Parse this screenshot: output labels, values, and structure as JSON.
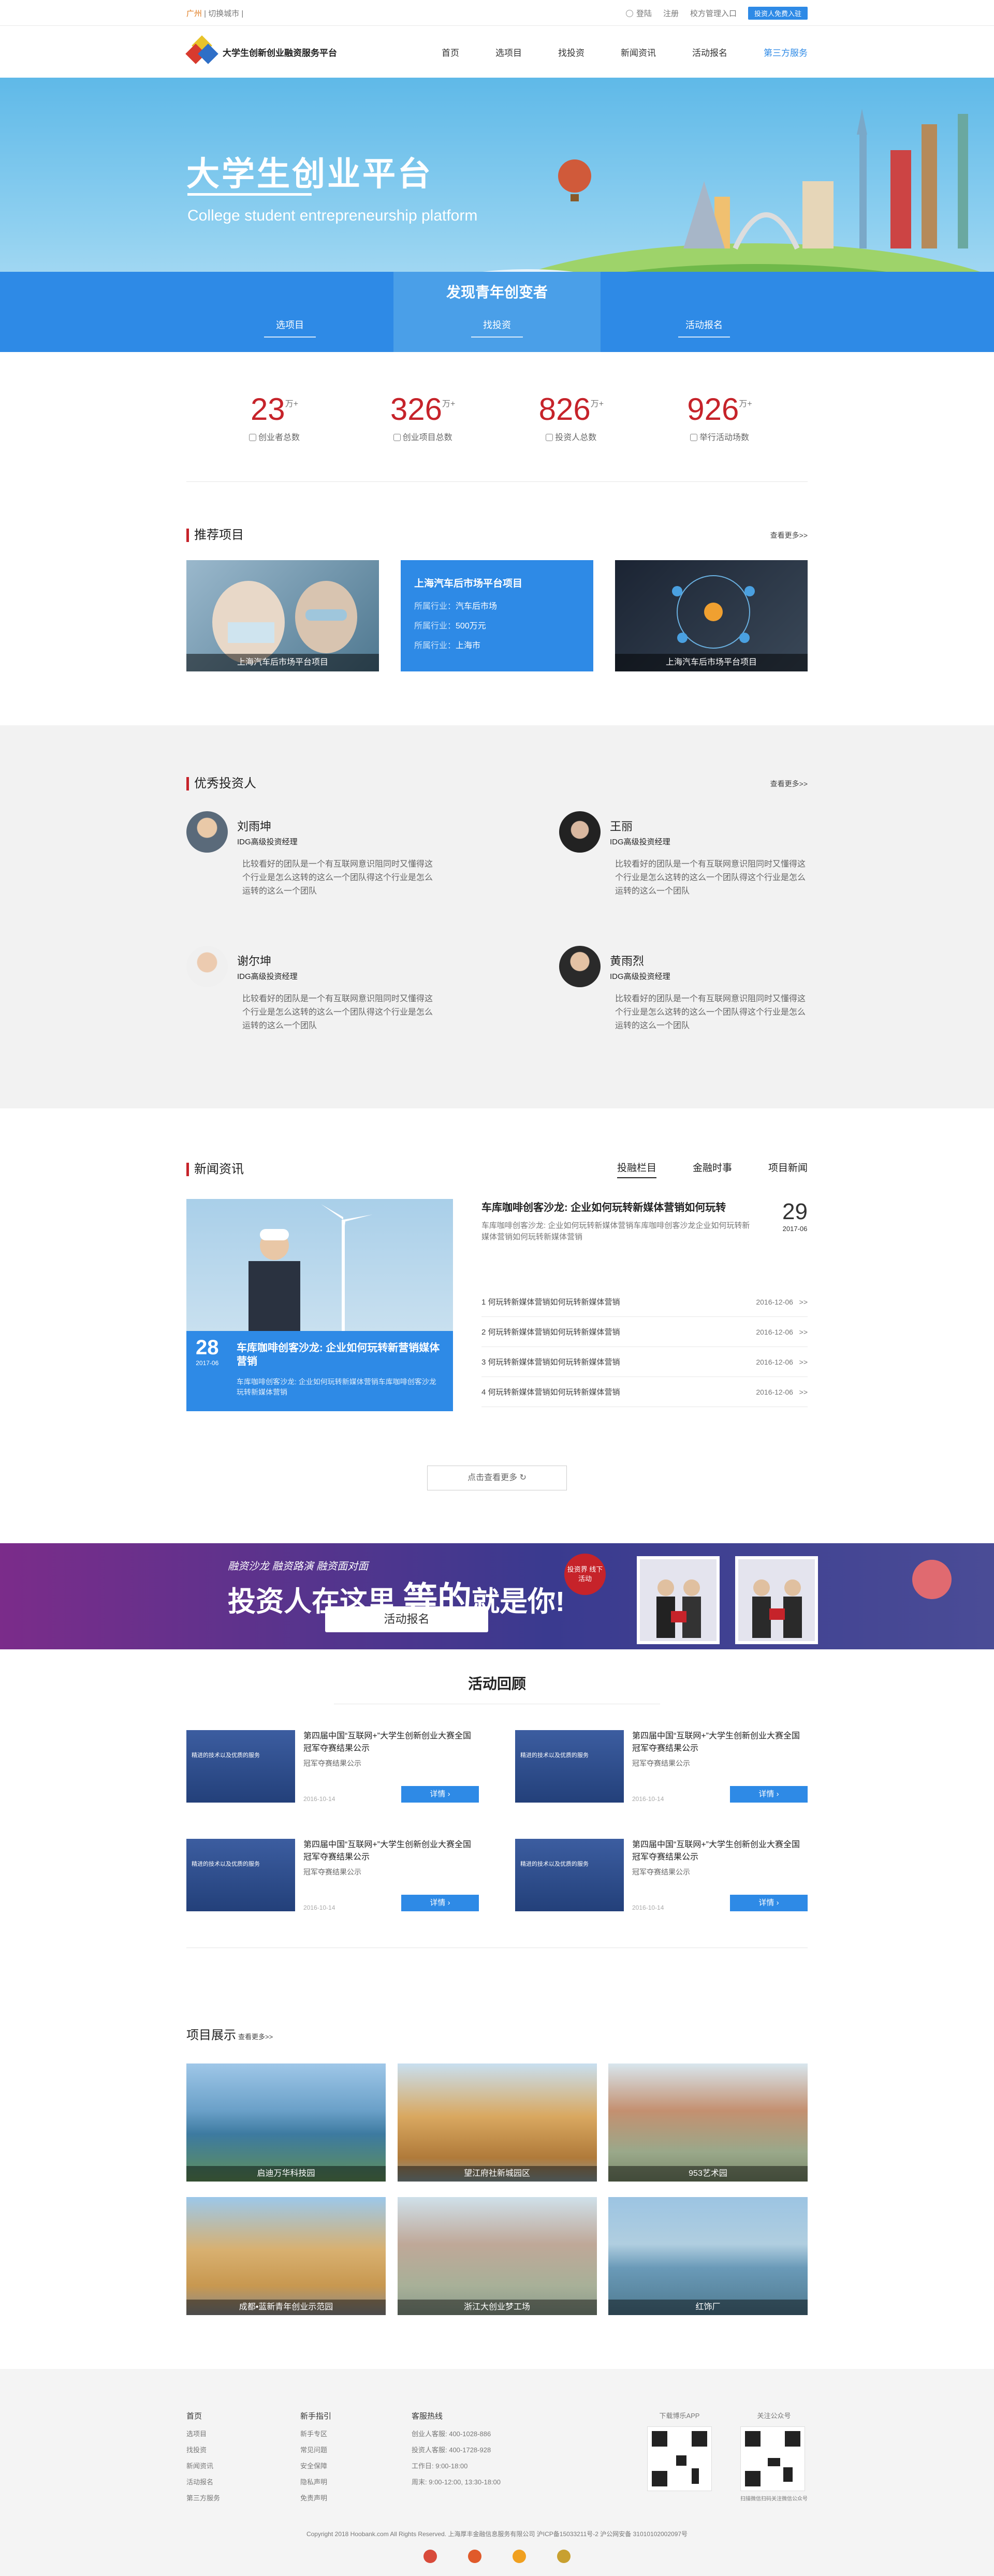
{
  "topbar": {
    "city": "广州",
    "switch_city": "切换城市",
    "login": "登陆",
    "register": "注册",
    "school_login": "校方管理入口",
    "investor_btn": "投资人免费入驻"
  },
  "nav": {
    "logo_text": "大学生创新创业融资服务平台",
    "items": [
      "首页",
      "选项目",
      "找投资",
      "新闻资讯",
      "活动报名",
      "第三方服务"
    ]
  },
  "hero": {
    "title": "大学生创业平台",
    "subtitle": "College student entrepreneurship platform",
    "bar_heading": "发现青年创变者",
    "bar_links": [
      "选项目",
      "找投资",
      "活动报名"
    ]
  },
  "stats": [
    {
      "num": "23",
      "unit": "万+",
      "label": "创业者总数"
    },
    {
      "num": "326",
      "unit": "万+",
      "label": "创业项目总数"
    },
    {
      "num": "826",
      "unit": "万+",
      "label": "投资人总数"
    },
    {
      "num": "926",
      "unit": "万+",
      "label": "举行活动场数"
    }
  ],
  "recommend": {
    "title": "推荐项目",
    "more": "查看更多>>",
    "left_caption": "上海汽车后市场平台项目",
    "mid": {
      "title": "上海汽车后市场平台项目",
      "rows": [
        {
          "k": "所属行业：",
          "v": "汽车后市场"
        },
        {
          "k": "所属行业：",
          "v": "500万元"
        },
        {
          "k": "所属行业：",
          "v": "上海市"
        }
      ]
    },
    "right_caption": "上海汽车后市场平台项目"
  },
  "investors": {
    "title": "优秀投资人",
    "more": "查看更多>>",
    "items": [
      {
        "name": "刘雨坤",
        "role": "IDG高级投资经理",
        "desc": "比较看好的团队是一个有互联网意识阻同时又懂得这个行业是怎么这转的这么一个团队得这个行业是怎么运转的这么一个团队"
      },
      {
        "name": "王丽",
        "role": "IDG高级投资经理",
        "desc": "比较看好的团队是一个有互联网意识阻同时又懂得这个行业是怎么这转的这么一个团队得这个行业是怎么运转的这么一个团队"
      },
      {
        "name": "谢尔坤",
        "role": "IDG高级投资经理",
        "desc": "比较看好的团队是一个有互联网意识阻同时又懂得这个行业是怎么这转的这么一个团队得这个行业是怎么运转的这么一个团队"
      },
      {
        "name": "黄雨烈",
        "role": "IDG高级投资经理",
        "desc": "比较看好的团队是一个有互联网意识阻同时又懂得这个行业是怎么这转的这么一个团队得这个行业是怎么运转的这么一个团队"
      }
    ]
  },
  "news": {
    "title": "新闻资讯",
    "tabs": [
      "投融栏目",
      "金融时事",
      "项目新闻"
    ],
    "feature": {
      "day": "28",
      "month": "2017-06",
      "title": "车库咖啡创客沙龙: 企业如何玩转新营销媒体营销",
      "desc": "车库咖啡创客沙龙: 企业如何玩转新媒体营销车库咖啡创客沙龙玩转新媒体营销"
    },
    "headline": {
      "title": "车库咖啡创客沙龙: 企业如何玩转新媒体营销如何玩转",
      "desc": "车库咖啡创客沙龙: 企业如何玩转新媒体营销车库咖啡创客沙龙企业如何玩转新媒体营销如何玩转新媒体营销",
      "day": "29",
      "month": "2017-06"
    },
    "list": [
      {
        "title": "1 何玩转新媒体营销如何玩转新媒体营销",
        "date": "2016-12-06",
        "arrow": ">>"
      },
      {
        "title": "2 何玩转新媒体营销如何玩转新媒体营销",
        "date": "2016-12-06",
        "arrow": ">>"
      },
      {
        "title": "3 何玩转新媒体营销如何玩转新媒体营销",
        "date": "2016-12-06",
        "arrow": ">>"
      },
      {
        "title": "4 何玩转新媒体营销如何玩转新媒体营销",
        "date": "2016-12-06",
        "arrow": ">>"
      }
    ],
    "more": "点击查看更多"
  },
  "banner": {
    "line1": "融资沙龙 融资路演 融资面对面",
    "line2a": "投资人在这里",
    "line2b": "等的",
    "line2c": "就是你!",
    "btn": "活动报名",
    "stamp": "投资界 线下活动"
  },
  "activity": {
    "title": "活动回顾",
    "items": [
      {
        "img_text": "精进的技术以及优质的服务",
        "title": "第四届中国“互联网+”大学生创新创业大赛全国冠军夺赛结果公示",
        "sub": "冠军夺赛结果公示",
        "date": "2016-10-14",
        "btn": "详情"
      },
      {
        "img_text": "精进的技术以及优质的服务",
        "title": "第四届中国“互联网+”大学生创新创业大赛全国冠军夺赛结果公示",
        "sub": "冠军夺赛结果公示",
        "date": "2016-10-14",
        "btn": "详情"
      },
      {
        "img_text": "精进的技术以及优质的服务",
        "title": "第四届中国“互联网+”大学生创新创业大赛全国冠军夺赛结果公示",
        "sub": "冠军夺赛结果公示",
        "date": "2016-10-14",
        "btn": "详情"
      },
      {
        "img_text": "精进的技术以及优质的服务",
        "title": "第四届中国“互联网+”大学生创新创业大赛全国冠军夺赛结果公示",
        "sub": "冠军夺赛结果公示",
        "date": "2016-10-14",
        "btn": "详情"
      }
    ]
  },
  "projects": {
    "title": "项目展示",
    "more": "查看更多>>",
    "items": [
      "启迪万华科技园",
      "望江府社新城园区",
      "953艺术园",
      "成都•蓝新青年创业示范园",
      "浙江大创业梦工场",
      "红饰厂"
    ]
  },
  "footer": {
    "cols": [
      {
        "h": "首页",
        "items": [
          "选项目",
          "找投资",
          "新闻资讯",
          "活动报名",
          "第三方服务"
        ]
      },
      {
        "h": "新手指引",
        "items": [
          "新手专区",
          "常见问题",
          "安全保障",
          "隐私声明",
          "免责声明"
        ]
      },
      {
        "h": "客服热线",
        "items": [
          "创业人客服: 400-1028-886",
          "投资人客服: 400-1728-928",
          "工作日: 9:00-18:00",
          "周末: 9:00-12:00, 13:30-18:00"
        ]
      }
    ],
    "app": "下载博乐APP",
    "wechat": "关注公众号",
    "wechat_sub": "扫描微信扫码关注微信公众号",
    "copyright": "Copyright 2018 Hoobank.com All Rights Reserved.  上海厚丰金融信息服务有限公司  沪ICP备15033211号-2  沪公网安备 31010102002097号"
  }
}
